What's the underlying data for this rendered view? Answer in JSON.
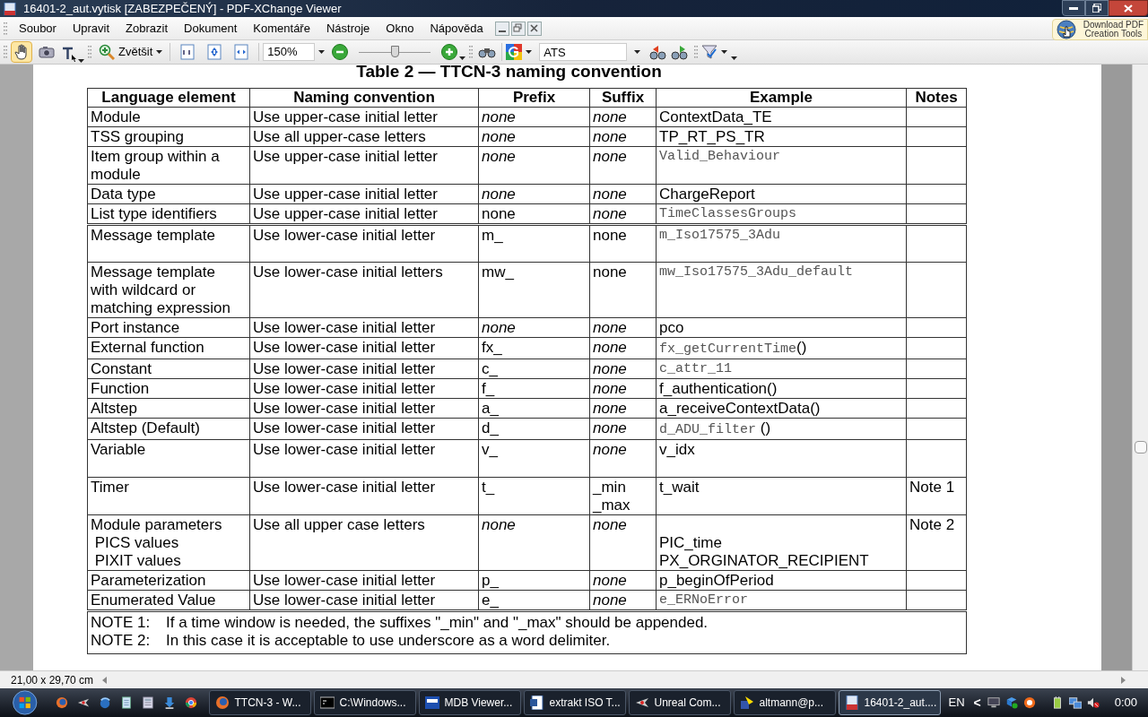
{
  "window": {
    "title": "16401-2_aut.vytisk [ZABEZPEČENÝ] - PDF-XChange Viewer"
  },
  "menu": [
    "Soubor",
    "Upravit",
    "Zobrazit",
    "Dokument",
    "Komentáře",
    "Nástroje",
    "Okno",
    "Nápověda"
  ],
  "promo_button": {
    "lines": [
      "Download PDF",
      "Creation Tools"
    ]
  },
  "toolbar": {
    "hand_tool": {
      "selected": true
    },
    "zoom_button": "Zvětšit",
    "zoom_value": "150%",
    "zoom_slider": {
      "level": 0.5
    },
    "search_value": "ATS"
  },
  "document": {
    "table_title": "Table 2 — TTCN-3 naming convention",
    "columns": [
      "Language element",
      "Naming convention",
      "Prefix",
      "Suffix",
      "Example",
      "Notes"
    ],
    "rows": [
      {
        "section_break": false,
        "cells": [
          {
            "lines": [
              "Module"
            ],
            "kind": "plain"
          },
          {
            "lines": [
              "Use upper-case initial letter"
            ],
            "kind": "plain"
          },
          {
            "lines": [
              "none"
            ],
            "kind": "italic"
          },
          {
            "lines": [
              "none"
            ],
            "kind": "italic"
          },
          {
            "lines": [
              "ContextData_TE"
            ],
            "kind": "plain"
          }
        ]
      },
      {
        "section_break": false,
        "cells": [
          {
            "lines": [
              "TSS grouping"
            ],
            "kind": "plain"
          },
          {
            "lines": [
              "Use all upper-case letters"
            ],
            "kind": "plain"
          },
          {
            "lines": [
              "none"
            ],
            "kind": "italic"
          },
          {
            "lines": [
              "none"
            ],
            "kind": "italic"
          },
          {
            "lines": [
              "TP_RT_PS_TR"
            ],
            "kind": "plain"
          }
        ]
      },
      {
        "section_break": false,
        "cells": [
          {
            "lines": [
              "Item group within a",
              "module"
            ],
            "kind": "plain"
          },
          {
            "lines": [
              "Use upper-case initial letter"
            ],
            "kind": "plain"
          },
          {
            "lines": [
              "none"
            ],
            "kind": "italic"
          },
          {
            "lines": [
              "none"
            ],
            "kind": "italic"
          },
          {
            "lines": [
              "Valid_Behaviour"
            ],
            "kind": "mono"
          }
        ]
      },
      {
        "section_break": false,
        "cells": [
          {
            "lines": [
              "Data type"
            ],
            "kind": "plain"
          },
          {
            "lines": [
              "Use upper-case initial letter"
            ],
            "kind": "plain"
          },
          {
            "lines": [
              "none"
            ],
            "kind": "italic"
          },
          {
            "lines": [
              "none"
            ],
            "kind": "italic"
          },
          {
            "lines": [
              "ChargeReport"
            ],
            "kind": "plain"
          }
        ]
      },
      {
        "section_break": false,
        "cells": [
          {
            "lines": [
              "List type identifiers"
            ],
            "kind": "plain"
          },
          {
            "lines": [
              "Use upper-case initial letter"
            ],
            "kind": "plain"
          },
          {
            "lines": [
              "none"
            ],
            "kind": "plain"
          },
          {
            "lines": [
              "none"
            ],
            "kind": "italic"
          },
          {
            "lines": [
              "TimeClassesGroups"
            ],
            "kind": "mono"
          }
        ]
      },
      {
        "section_break": true,
        "tall": true,
        "cells": [
          {
            "lines": [
              "Message template"
            ],
            "kind": "plain"
          },
          {
            "lines": [
              "Use lower-case initial letter"
            ],
            "kind": "plain"
          },
          {
            "lines": [
              "m_"
            ],
            "kind": "plain"
          },
          {
            "lines": [
              "none"
            ],
            "kind": "plain"
          },
          {
            "lines": [
              "m_Iso17575_3Adu"
            ],
            "kind": "mono"
          }
        ]
      },
      {
        "section_break": false,
        "cells": [
          {
            "lines": [
              "Message template",
              "with wildcard or",
              "matching expression"
            ],
            "kind": "plain"
          },
          {
            "lines": [
              "Use lower-case initial letters"
            ],
            "kind": "plain"
          },
          {
            "lines": [
              "mw_"
            ],
            "kind": "plain"
          },
          {
            "lines": [
              "none"
            ],
            "kind": "plain"
          },
          {
            "lines": [
              "mw_Iso17575_3Adu_default"
            ],
            "kind": "mono"
          }
        ]
      },
      {
        "section_break": false,
        "cells": [
          {
            "lines": [
              "Port instance"
            ],
            "kind": "plain"
          },
          {
            "lines": [
              "Use lower-case initial letter"
            ],
            "kind": "plain"
          },
          {
            "lines": [
              "none"
            ],
            "kind": "italic"
          },
          {
            "lines": [
              "none"
            ],
            "kind": "italic"
          },
          {
            "lines": [
              "pco"
            ],
            "kind": "plain"
          }
        ]
      },
      {
        "section_break": false,
        "cells": [
          {
            "lines": [
              "External function"
            ],
            "kind": "plain"
          },
          {
            "lines": [
              "Use lower-case initial letter"
            ],
            "kind": "plain"
          },
          {
            "lines": [
              "fx_"
            ],
            "kind": "plain"
          },
          {
            "lines": [
              "none"
            ],
            "kind": "italic"
          },
          {
            "lines": [
              "fx_getCurrentTime()"
            ],
            "kind": "mono_call"
          }
        ]
      },
      {
        "section_break": false,
        "cells": [
          {
            "lines": [
              "Constant"
            ],
            "kind": "plain"
          },
          {
            "lines": [
              "Use lower-case initial letter"
            ],
            "kind": "plain"
          },
          {
            "lines": [
              "c_"
            ],
            "kind": "plain"
          },
          {
            "lines": [
              "none"
            ],
            "kind": "italic"
          },
          {
            "lines": [
              "c_attr_11"
            ],
            "kind": "mono"
          }
        ]
      },
      {
        "section_break": false,
        "cells": [
          {
            "lines": [
              "Function"
            ],
            "kind": "plain"
          },
          {
            "lines": [
              "Use lower-case initial letter"
            ],
            "kind": "plain"
          },
          {
            "lines": [
              "f_"
            ],
            "kind": "plain"
          },
          {
            "lines": [
              "none"
            ],
            "kind": "italic"
          },
          {
            "lines": [
              "f_authentication()"
            ],
            "kind": "plain"
          }
        ]
      },
      {
        "section_break": false,
        "cells": [
          {
            "lines": [
              "Altstep"
            ],
            "kind": "plain"
          },
          {
            "lines": [
              "Use lower-case initial letter"
            ],
            "kind": "plain"
          },
          {
            "lines": [
              "a_"
            ],
            "kind": "plain"
          },
          {
            "lines": [
              "none"
            ],
            "kind": "italic"
          },
          {
            "lines": [
              "a_receiveContextData()"
            ],
            "kind": "plain"
          }
        ]
      },
      {
        "section_break": false,
        "cells": [
          {
            "lines": [
              "Altstep (Default)"
            ],
            "kind": "plain"
          },
          {
            "lines": [
              "Use lower-case initial letter"
            ],
            "kind": "plain"
          },
          {
            "lines": [
              "d_"
            ],
            "kind": "plain"
          },
          {
            "lines": [
              "none"
            ],
            "kind": "italic"
          },
          {
            "lines": [
              "d_ADU_filter ()"
            ],
            "kind": "mono_call"
          }
        ]
      },
      {
        "section_break": false,
        "tall": true,
        "cells": [
          {
            "lines": [
              "Variable"
            ],
            "kind": "plain"
          },
          {
            "lines": [
              "Use lower-case initial letter"
            ],
            "kind": "plain"
          },
          {
            "lines": [
              "v_"
            ],
            "kind": "plain"
          },
          {
            "lines": [
              "none"
            ],
            "kind": "italic"
          },
          {
            "lines": [
              "v_idx"
            ],
            "kind": "plain"
          }
        ]
      },
      {
        "section_break": false,
        "cells": [
          {
            "lines": [
              "Timer"
            ],
            "kind": "plain"
          },
          {
            "lines": [
              "Use lower-case initial letter"
            ],
            "kind": "plain"
          },
          {
            "lines": [
              "t_"
            ],
            "kind": "plain"
          },
          {
            "lines": [
              "_min",
              "_max"
            ],
            "kind": "plain"
          },
          {
            "lines": [
              "t_wait"
            ],
            "kind": "plain"
          },
          {
            "lines": [
              "Note 1"
            ],
            "kind": "plain"
          }
        ]
      },
      {
        "section_break": false,
        "cells": [
          {
            "lines": [
              "Module parameters",
              " PICS values",
              " PIXIT values"
            ],
            "kind": "plain"
          },
          {
            "lines": [
              "Use all upper case letters"
            ],
            "kind": "plain"
          },
          {
            "lines": [
              "none"
            ],
            "kind": "italic"
          },
          {
            "lines": [
              "none"
            ],
            "kind": "italic"
          },
          {
            "lines": [
              "PIC_time",
              "PX_ORGINATOR_RECIPIENT"
            ],
            "kind": "plain",
            "skip_first_line": true
          },
          {
            "lines": [
              "Note 2"
            ],
            "kind": "plain"
          }
        ]
      },
      {
        "section_break": false,
        "cells": [
          {
            "lines": [
              "Parameterization"
            ],
            "kind": "plain"
          },
          {
            "lines": [
              "Use lower-case initial letter"
            ],
            "kind": "plain"
          },
          {
            "lines": [
              "p_"
            ],
            "kind": "plain"
          },
          {
            "lines": [
              "none"
            ],
            "kind": "italic"
          },
          {
            "lines": [
              "p_beginOfPeriod"
            ],
            "kind": "plain"
          }
        ]
      },
      {
        "section_break": false,
        "cells": [
          {
            "lines": [
              "Enumerated Value"
            ],
            "kind": "plain"
          },
          {
            "lines": [
              "Use lower-case initial letter"
            ],
            "kind": "plain"
          },
          {
            "lines": [
              "e_"
            ],
            "kind": "plain"
          },
          {
            "lines": [
              "none"
            ],
            "kind": "italic"
          },
          {
            "lines": [
              "e_ERNoError"
            ],
            "kind": "mono"
          }
        ]
      }
    ],
    "notes": [
      {
        "label": "NOTE 1:",
        "text": "If a time window is needed, the suffixes \"_min\" and \"_max\" should be appended."
      },
      {
        "label": "NOTE 2:",
        "text": "In this case it is acceptable to use underscore as a word delimiter."
      }
    ]
  },
  "status_bar": {
    "page_size": "21,00 x 29,70 cm"
  },
  "taskbar": {
    "tasks": [
      {
        "kind": "firefox",
        "label": "TTCN-3 - W...",
        "selected": false
      },
      {
        "kind": "console",
        "label": "C:\\Windows...",
        "selected": false
      },
      {
        "kind": "database",
        "label": "MDB Viewer...",
        "selected": false
      },
      {
        "kind": "document",
        "label": "extrakt ISO T...",
        "selected": false
      },
      {
        "kind": "game",
        "label": "Unreal Com...",
        "selected": false
      },
      {
        "kind": "terminal",
        "label": "altmann@p...",
        "selected": false
      },
      {
        "kind": "pdf",
        "label": "16401-2_aut....",
        "selected": true
      }
    ],
    "language": "EN",
    "tray_expand": "<",
    "clock": "0:00"
  }
}
